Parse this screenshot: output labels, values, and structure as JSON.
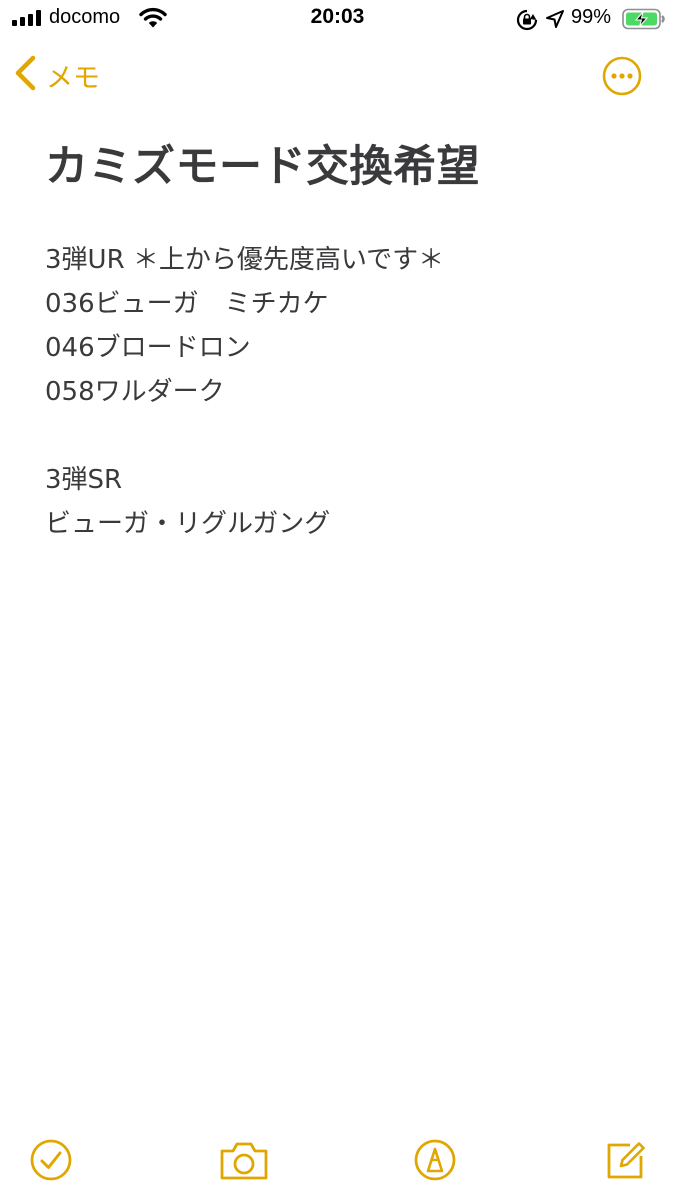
{
  "status_bar": {
    "carrier": "docomo",
    "time": "20:03",
    "battery_percent": "99%",
    "icons": [
      "signal-bars-icon",
      "wifi-icon",
      "orientation-lock-icon",
      "location-arrow-icon",
      "battery-charging-icon"
    ]
  },
  "nav": {
    "back_label": "メモ",
    "back_icon": "chevron-left-icon",
    "more_icon": "ellipsis-circle-icon"
  },
  "note": {
    "title": "カミズモード交換希望",
    "lines": [
      "3弾UR ＊上から優先度高いです＊",
      "036ビューガ　ミチカケ",
      "046ブロードロン",
      "058ワルダーク",
      "",
      "3弾SR",
      "ビューガ・リグルガング"
    ]
  },
  "toolbar": {
    "icons": [
      "checklist-icon",
      "camera-icon",
      "markup-pen-icon",
      "compose-icon"
    ]
  },
  "colors": {
    "accent": "#e0a702",
    "text": "#3a3a3c",
    "battery_green": "#4cd964"
  }
}
